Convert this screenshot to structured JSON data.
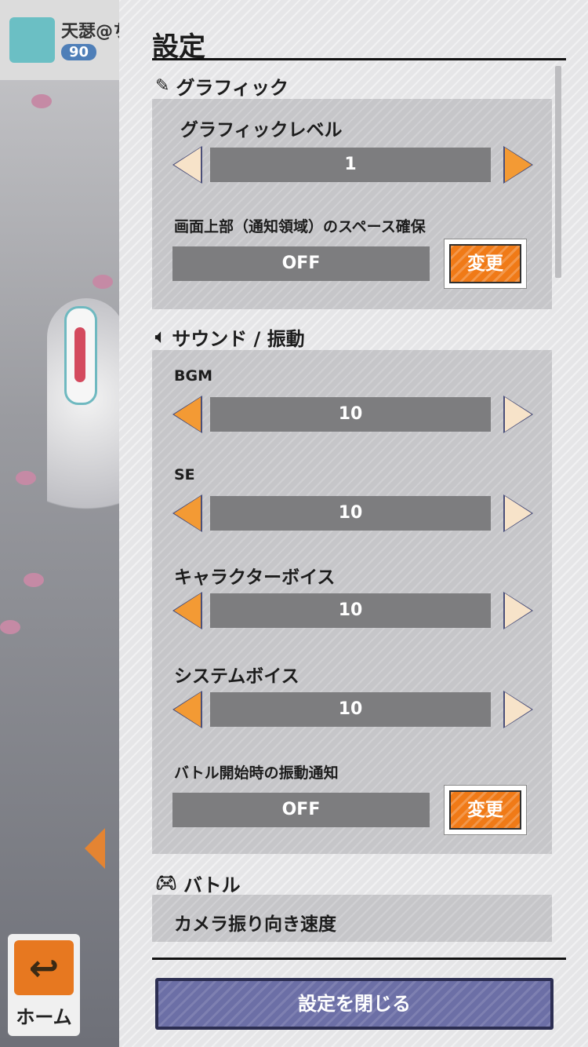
{
  "background": {
    "player_name": "天瑟@ちゃん",
    "player_level": "90",
    "home_label": "ホーム",
    "home_icon": "return-arrow-icon"
  },
  "panel": {
    "title": "設定",
    "close_label": "設定を閉じる",
    "sections": {
      "graphics": {
        "title": "グラフィック",
        "icon": "pencil-icon",
        "level_label": "グラフィックレベル",
        "level_value": "1",
        "notch_label": "画面上部（通知領域）のスペース確保",
        "notch_value": "OFF",
        "change_label": "変更"
      },
      "sound": {
        "title": "サウンド / 振動",
        "icon": "speaker-icon",
        "bgm_label": "BGM",
        "bgm_value": "10",
        "se_label": "SE",
        "se_value": "10",
        "voice_label": "キャラクターボイス",
        "voice_value": "10",
        "system_voice_label": "システムボイス",
        "system_voice_value": "10",
        "vibration_label": "バトル開始時の振動通知",
        "vibration_value": "OFF",
        "change_label": "変更"
      },
      "battle": {
        "title": "バトル",
        "icon": "gamepad-icon",
        "camera_label": "カメラ振り向き速度"
      }
    }
  },
  "colors": {
    "accent_orange": "#f07a17",
    "arrow_active": "#f39a34",
    "arrow_inactive": "#f7e3c9",
    "close_button": "#6c6fa6"
  }
}
